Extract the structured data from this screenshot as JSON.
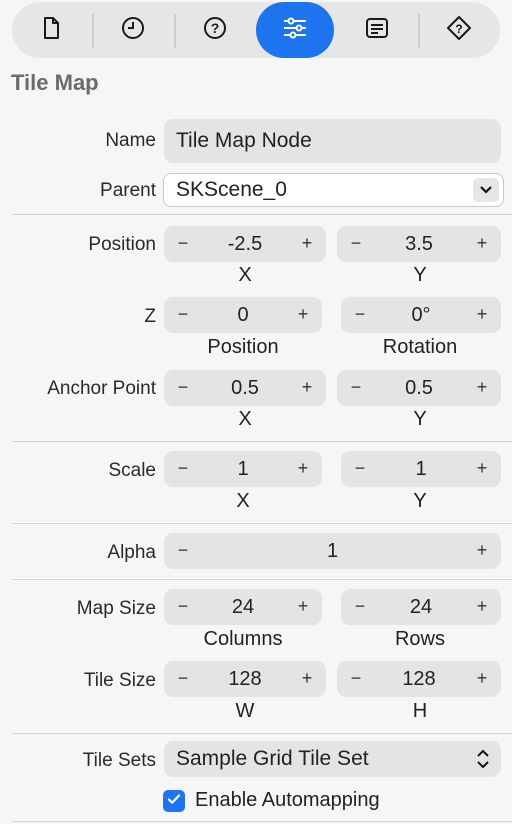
{
  "toolbar": {
    "tabs": [
      {
        "icon": "file-icon",
        "active": false
      },
      {
        "icon": "clock-icon",
        "active": false
      },
      {
        "icon": "help-icon",
        "active": false
      },
      {
        "icon": "sliders-icon",
        "active": true
      },
      {
        "icon": "attributes-icon",
        "active": false
      },
      {
        "icon": "diamond-icon",
        "active": false
      }
    ],
    "accent": "#1e73ef"
  },
  "section_title": "Tile Map",
  "name": {
    "label": "Name",
    "value": "Tile Map Node"
  },
  "parent": {
    "label": "Parent",
    "value": "SKScene_0"
  },
  "position": {
    "label": "Position",
    "x": "-2.5",
    "y": "3.5",
    "x_sub": "X",
    "y_sub": "Y"
  },
  "z": {
    "label": "Z",
    "position": "0",
    "rotation": "0°",
    "position_sub": "Position",
    "rotation_sub": "Rotation"
  },
  "anchor": {
    "label": "Anchor Point",
    "x": "0.5",
    "y": "0.5",
    "x_sub": "X",
    "y_sub": "Y"
  },
  "scale": {
    "label": "Scale",
    "x": "1",
    "y": "1",
    "x_sub": "X",
    "y_sub": "Y"
  },
  "alpha": {
    "label": "Alpha",
    "value": "1"
  },
  "map_size": {
    "label": "Map Size",
    "columns": "24",
    "rows": "24",
    "columns_sub": "Columns",
    "rows_sub": "Rows"
  },
  "tile_size": {
    "label": "Tile Size",
    "w": "128",
    "h": "128",
    "w_sub": "W",
    "h_sub": "H"
  },
  "tile_sets": {
    "label": "Tile Sets",
    "value": "Sample Grid Tile Set"
  },
  "automapping": {
    "label": "Enable Automapping",
    "checked": true
  },
  "stepper": {
    "minus": "−",
    "plus": "+"
  }
}
